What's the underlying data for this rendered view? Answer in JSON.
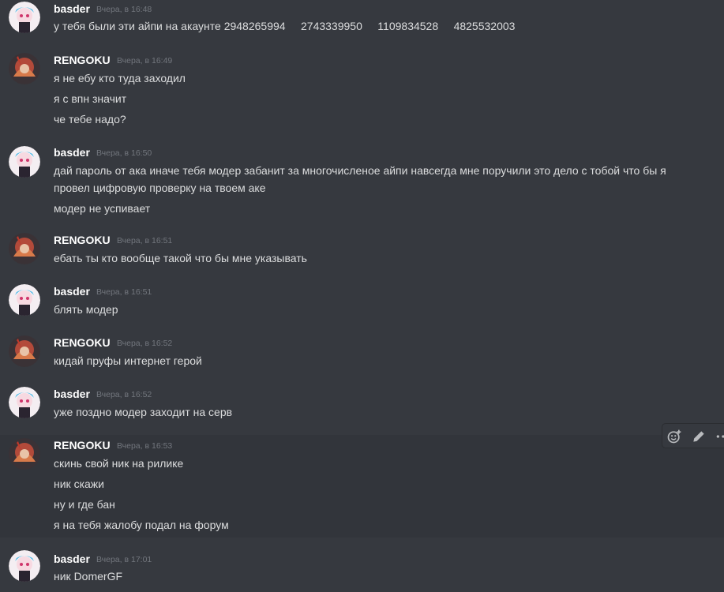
{
  "users": {
    "basder": "basder",
    "rengoku": "RENGOKU"
  },
  "groups": [
    {
      "author": "basder",
      "timestamp": "Вчера, в 16:48",
      "lines": [
        "у тебя были эти айпи на акаунте 2948265994     2743339950     1109834528     4825532003"
      ]
    },
    {
      "author": "RENGOKU",
      "timestamp": "Вчера, в 16:49",
      "lines": [
        "я не ебу кто туда заходил",
        "я с впн значит",
        "че тебе надо?"
      ]
    },
    {
      "author": "basder",
      "timestamp": "Вчера, в 16:50",
      "lines": [
        "дай пароль от ака иначе тебя модер забанит за многочисленое айпи навсегда мне поручили это дело с тобой что бы я",
        "провел цифровую проверку на твоем аке",
        "модер не успивает"
      ]
    },
    {
      "author": "RENGOKU",
      "timestamp": "Вчера, в 16:51",
      "lines": [
        "ебать ты кто вообще такой что бы мне указывать"
      ]
    },
    {
      "author": "basder",
      "timestamp": "Вчера, в 16:51",
      "lines": [
        "блять модер"
      ]
    },
    {
      "author": "RENGOKU",
      "timestamp": "Вчера, в 16:52",
      "lines": [
        "кидай пруфы интернет герой"
      ]
    },
    {
      "author": "basder",
      "timestamp": "Вчера, в 16:52",
      "lines": [
        "уже поздно модер заходит на серв"
      ]
    },
    {
      "author": "RENGOKU",
      "timestamp": "Вчера, в 16:53",
      "lines": [
        "скинь свой ник на рилике",
        "ник скажи",
        "ну и где бан",
        "я на тебя жалобу подал на форум"
      ]
    },
    {
      "author": "basder",
      "timestamp": "Вчера, в 17:01",
      "lines": [
        "ник DomerGF"
      ]
    }
  ],
  "toolbar": {
    "icons": [
      "add-reaction-icon",
      "edit-icon",
      "more-icon"
    ]
  },
  "colors": {
    "background": "#36393f",
    "hover": "#32353b",
    "author": "#ffffff",
    "timestamp": "#72767d",
    "text": "#dcddde"
  }
}
